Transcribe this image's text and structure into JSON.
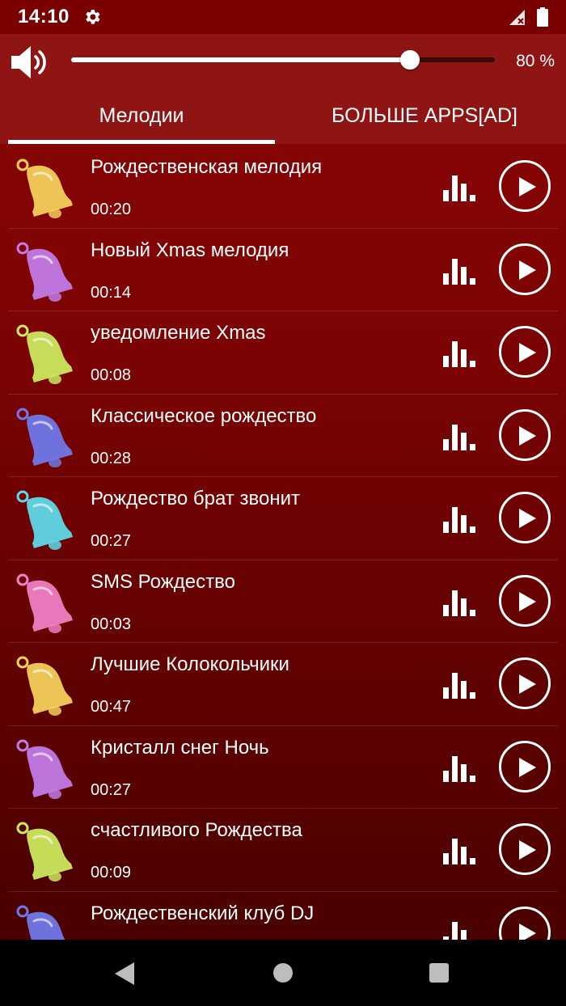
{
  "status_bar": {
    "time": "14:10"
  },
  "volume": {
    "level": 0.8,
    "percent_label": "80 %"
  },
  "tabs": [
    {
      "label": "Мелодии",
      "active": true
    },
    {
      "label": "БОЛЬШЕ APPS[AD]",
      "active": false
    }
  ],
  "melodies": [
    {
      "title": "Рождественская мелодия",
      "duration": "00:20",
      "bell_color": "#f2cf5a"
    },
    {
      "title": "Новый Xmas мелодия",
      "duration": "00:14",
      "bell_color": "#c27ae6"
    },
    {
      "title": "уведомление Xmas",
      "duration": "00:08",
      "bell_color": "#cbe85e"
    },
    {
      "title": "Классическое рождество",
      "duration": "00:28",
      "bell_color": "#6f78e8"
    },
    {
      "title": "Рождество брат звонит",
      "duration": "00:27",
      "bell_color": "#5fd9e6"
    },
    {
      "title": "SMS Рождество",
      "duration": "00:03",
      "bell_color": "#f07ec4"
    },
    {
      "title": "Лучшие Колокольчики",
      "duration": "00:47",
      "bell_color": "#f2cf5a"
    },
    {
      "title": "Кристалл снег Ночь",
      "duration": "00:27",
      "bell_color": "#c27ae6"
    },
    {
      "title": "счастливого Рождества",
      "duration": "00:09",
      "bell_color": "#cbe85e"
    },
    {
      "title": "Рождественский клуб DJ",
      "duration": "",
      "bell_color": "#6f78e8"
    }
  ],
  "colors": {
    "background": "#7a0303",
    "header": "#8f1515",
    "status_bar": "#7a0000"
  },
  "icons": {
    "settings": "gear-icon",
    "speaker": "speaker-icon",
    "equalizer": "equalizer-icon",
    "play": "play-icon",
    "bell": "bell-icon"
  }
}
